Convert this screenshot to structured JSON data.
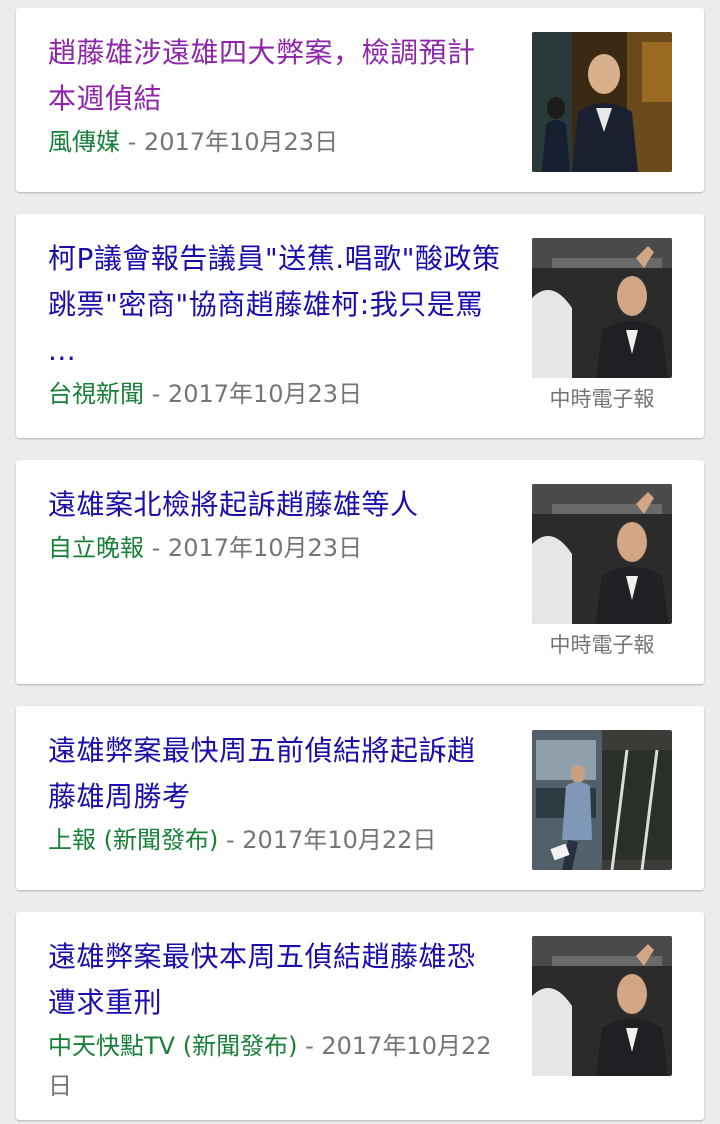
{
  "articles": [
    {
      "title": "趙藤雄涉遠雄四大弊案，檢調預計本週偵結",
      "source": "風傳媒",
      "separator": " - ",
      "date": "2017年10月23日",
      "thumb_caption": "",
      "visited": true
    },
    {
      "title": "柯P議會報告議員\"送蕉.唱歌\"酸政策跳票\"密商\"協商趙藤雄柯:我只是罵 ...",
      "source": "台視新聞",
      "separator": " - ",
      "date": "2017年10月23日",
      "thumb_caption": "中時電子報",
      "visited": false
    },
    {
      "title": "遠雄案北檢將起訴趙藤雄等人",
      "source": "自立晚報",
      "separator": " - ",
      "date": "2017年10月23日",
      "thumb_caption": "中時電子報",
      "visited": false
    },
    {
      "title": "遠雄弊案最快周五前偵結將起訴趙藤雄周勝考",
      "source": "上報 (新聞發布)",
      "separator": " - ",
      "date": "2017年10月22日",
      "thumb_caption": "",
      "visited": false
    },
    {
      "title": "遠雄弊案最快本周五偵結趙藤雄恐遭求重刑",
      "source": "中天快點TV (新聞發布)",
      "separator": " - ",
      "date": "2017年10月22日",
      "thumb_caption": "",
      "visited": false
    }
  ],
  "colors": {
    "title_link": "#1a0dab",
    "title_visited": "#8e24aa",
    "source": "#188038",
    "meta_gray": "#757575",
    "background": "#ececec"
  }
}
